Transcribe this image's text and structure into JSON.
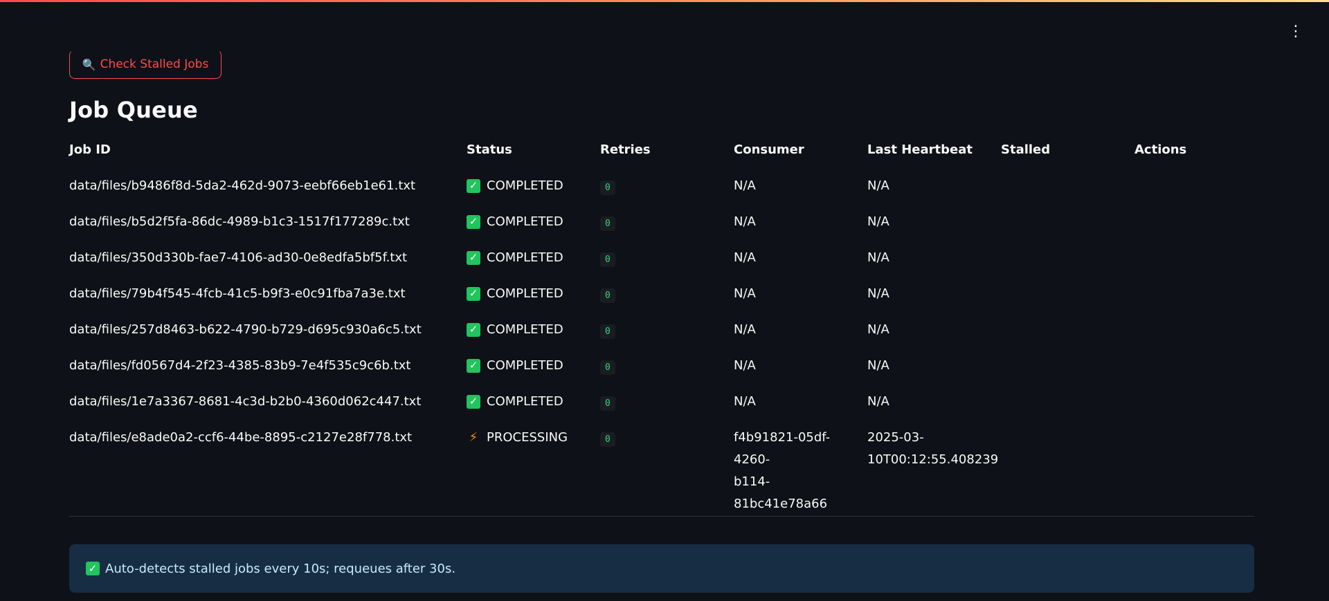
{
  "toolbar": {
    "check_stalled_label": "Check Stalled Jobs",
    "check_stalled_icon": "magnifier-icon",
    "menu_icon": "kebab-menu-icon"
  },
  "page": {
    "title": "Job Queue"
  },
  "table": {
    "headers": {
      "job_id": "Job ID",
      "status": "Status",
      "retries": "Retries",
      "consumer": "Consumer",
      "last_heartbeat": "Last Heartbeat",
      "stalled": "Stalled",
      "actions": "Actions"
    },
    "rows": [
      {
        "job_id": "data/files/b9486f8d-5da2-462d-9073-eebf66eb1e61.txt",
        "status": "COMPLETED",
        "status_icon": "check-icon",
        "retries": "0",
        "consumer": "N/A",
        "consumer_2": "",
        "heartbeat": "N/A",
        "heartbeat_2": ""
      },
      {
        "job_id": "data/files/b5d2f5fa-86dc-4989-b1c3-1517f177289c.txt",
        "status": "COMPLETED",
        "status_icon": "check-icon",
        "retries": "0",
        "consumer": "N/A",
        "consumer_2": "",
        "heartbeat": "N/A",
        "heartbeat_2": ""
      },
      {
        "job_id": "data/files/350d330b-fae7-4106-ad30-0e8edfa5bf5f.txt",
        "status": "COMPLETED",
        "status_icon": "check-icon",
        "retries": "0",
        "consumer": "N/A",
        "consumer_2": "",
        "heartbeat": "N/A",
        "heartbeat_2": ""
      },
      {
        "job_id": "data/files/79b4f545-4fcb-41c5-b9f3-e0c91fba7a3e.txt",
        "status": "COMPLETED",
        "status_icon": "check-icon",
        "retries": "0",
        "consumer": "N/A",
        "consumer_2": "",
        "heartbeat": "N/A",
        "heartbeat_2": ""
      },
      {
        "job_id": "data/files/257d8463-b622-4790-b729-d695c930a6c5.txt",
        "status": "COMPLETED",
        "status_icon": "check-icon",
        "retries": "0",
        "consumer": "N/A",
        "consumer_2": "",
        "heartbeat": "N/A",
        "heartbeat_2": ""
      },
      {
        "job_id": "data/files/fd0567d4-2f23-4385-83b9-7e4f535c9c6b.txt",
        "status": "COMPLETED",
        "status_icon": "check-icon",
        "retries": "0",
        "consumer": "N/A",
        "consumer_2": "",
        "heartbeat": "N/A",
        "heartbeat_2": ""
      },
      {
        "job_id": "data/files/1e7a3367-8681-4c3d-b2b0-4360d062c447.txt",
        "status": "COMPLETED",
        "status_icon": "check-icon",
        "retries": "0",
        "consumer": "N/A",
        "consumer_2": "",
        "heartbeat": "N/A",
        "heartbeat_2": ""
      },
      {
        "job_id": "data/files/e8ade0a2-ccf6-44be-8895-c2127e28f778.txt",
        "status": "PROCESSING",
        "status_icon": "lightning-bolt-icon",
        "retries": "0",
        "consumer": "f4b91821-05df-4260-",
        "consumer_2": "b114-81bc41e78a66",
        "heartbeat": "2025-03-",
        "heartbeat_2": "10T00:12:55.408239"
      }
    ]
  },
  "info_banner": {
    "text": "Auto-detects stalled jobs every 10s; requeues after 30s.",
    "icon": "check-icon"
  },
  "colors": {
    "background": "#0e1117",
    "accent": "#ff4b4b",
    "success": "#21c45d",
    "processing": "#ff8c1a",
    "info_bg": "#172d43"
  }
}
